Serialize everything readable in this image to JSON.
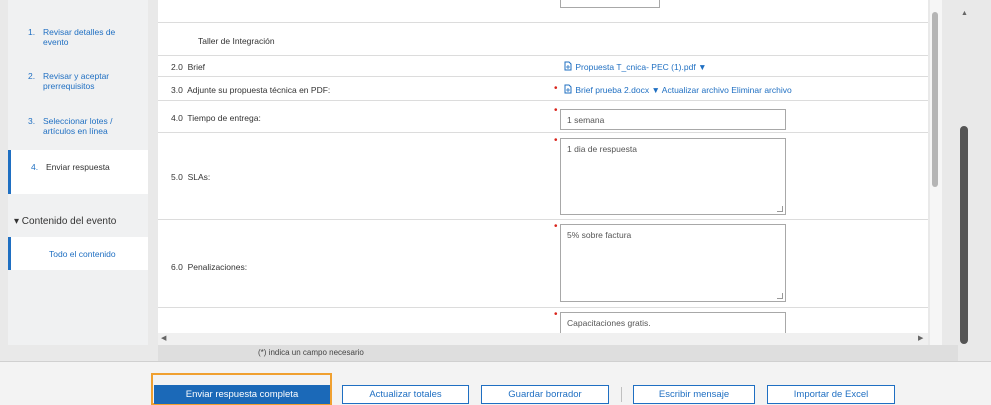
{
  "sidebar": {
    "steps": [
      {
        "num": "1.",
        "label": "Revisar detalles de evento"
      },
      {
        "num": "2.",
        "label": "Revisar y aceptar prerrequisitos"
      },
      {
        "num": "3.",
        "label": "Seleccionar lotes / artículos en línea"
      },
      {
        "num": "4.",
        "label": "Enviar respuesta"
      }
    ],
    "section_title": "▾ Contenido del evento",
    "section_item": "Todo el contenido"
  },
  "main": {
    "header_row": "Taller de Integración",
    "rows": [
      {
        "num": "2.0",
        "label": "Brief",
        "file": "Propuesta T_cnica- PEC (1).pdf"
      },
      {
        "num": "3.0",
        "label": "Adjunte su propuesta técnica en PDF:",
        "file": "Brief prueba 2.docx",
        "update": "Actualizar archivo",
        "delete": "Eliminar archivo"
      },
      {
        "num": "4.0",
        "label": "Tiempo de entrega:",
        "value": "1 semana"
      },
      {
        "num": "5.0",
        "label": "SLAs:",
        "value": "1 dia de respuesta"
      },
      {
        "num": "6.0",
        "label": "Penalizaciones:",
        "value": "5% sobre factura"
      },
      {
        "value": "Capacitaciones gratis."
      }
    ]
  },
  "footer_note": "(*) indica un campo necesario",
  "buttons": {
    "submit": "Enviar respuesta completa",
    "update_totals": "Actualizar totales",
    "save_draft": "Guardar borrador",
    "compose": "Escribir mensaje",
    "import": "Importar de Excel"
  },
  "colors": {
    "accent": "#1f6fc2",
    "primary": "#1b69b8",
    "highlight": "#f0a030",
    "required": "#d9251c"
  }
}
